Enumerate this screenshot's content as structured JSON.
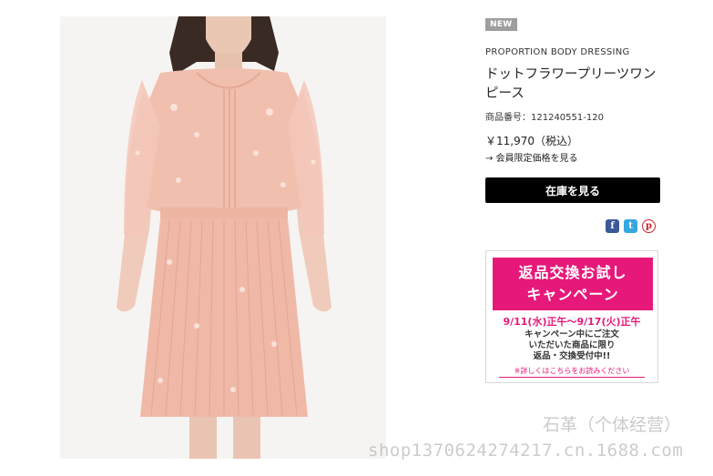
{
  "product": {
    "badge": "NEW",
    "brand": "PROPORTION BODY DRESSING",
    "title": "ドットフラワープリーツワンピース",
    "item_number": "商品番号：121240551-120",
    "price": "￥11,970（税込）",
    "member_price_link": "→ 会員限定価格を見る",
    "stock_button": "在庫を見る",
    "social_icons": [
      "facebook-icon",
      "twitter-icon",
      "pinterest-icon"
    ]
  },
  "campaign": {
    "heading_line1": "返品交換お試し",
    "heading_line2": "キャンペーン",
    "dates": "9/11(水)正午〜9/17(火)正午",
    "text_lines": [
      "キャンペーン中にご注文",
      "いただいた商品に限り",
      "返品・交換受付中!!"
    ],
    "details_link": "※詳しくはこちらをお読みください"
  },
  "watermarks": {
    "shop_name": "石革（个体经营）",
    "shop_url": "shop1370624274217.cn.1688.com"
  },
  "colors": {
    "accent_pink": "#e6197a",
    "button_black": "#000000",
    "badge_gray": "#9e9e9e"
  }
}
